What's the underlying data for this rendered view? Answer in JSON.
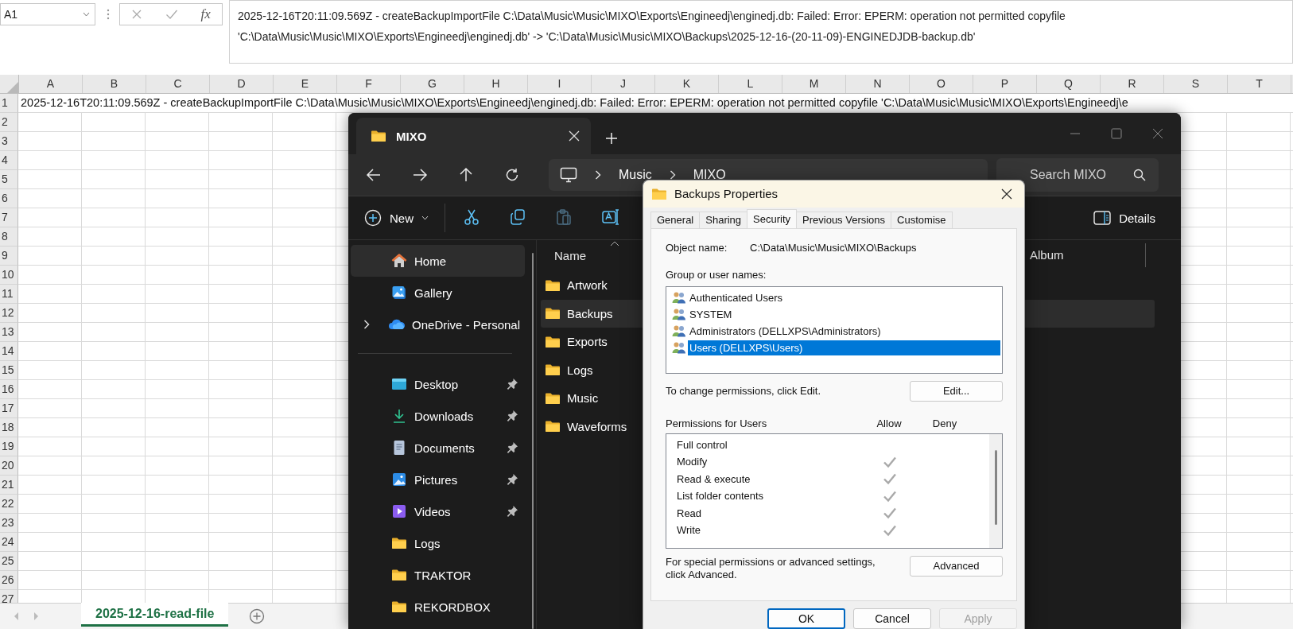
{
  "spreadsheet": {
    "name_box": "A1",
    "fx_label": "fx",
    "formula": "2025-12-16T20:11:09.569Z - createBackupImportFile C:\\Data\\Music\\Music\\MIXO\\Exports\\Engineedj\\enginedj.db: Failed: Error: EPERM: operation not permitted copyfile 'C:\\Data\\Music\\Music\\MIXO\\Exports\\Engineedj\\enginedj.db' -> 'C:\\Data\\Music\\Music\\MIXO\\Backups\\2025-12-16-(20-11-09)-ENGINEDJDB-backup.db'",
    "columns": [
      "A",
      "B",
      "C",
      "D",
      "E",
      "F",
      "G",
      "H",
      "I",
      "J",
      "K",
      "L",
      "M",
      "N",
      "O",
      "P",
      "Q",
      "R",
      "S",
      "T"
    ],
    "rows": [
      "1",
      "2",
      "3",
      "4",
      "5",
      "6",
      "7",
      "8",
      "9",
      "10",
      "11",
      "12",
      "13",
      "14",
      "15",
      "16",
      "17",
      "18",
      "19",
      "20",
      "21",
      "22",
      "23",
      "24",
      "25",
      "26",
      "27"
    ],
    "cell_a1": "2025-12-16T20:11:09.569Z - createBackupImportFile C:\\Data\\Music\\Music\\MIXO\\Exports\\Engineedj\\enginedj.db: Failed: Error: EPERM: operation not permitted copyfile 'C:\\Data\\Music\\Music\\MIXO\\Exports\\Engineedj\\e",
    "sheet_tabs": [
      {
        "label": "2025-12-16-read-file",
        "selected": true
      }
    ]
  },
  "explorer": {
    "tabs": [
      {
        "title": "MIXO",
        "selected": true
      }
    ],
    "breadcrumb": [
      "Music",
      "MIXO"
    ],
    "search": {
      "placeholder": "Search MIXO"
    },
    "new_label": "New",
    "toolbar_icons": [
      {
        "kind": "cut",
        "disabled": false
      },
      {
        "kind": "copy",
        "disabled": false
      },
      {
        "kind": "paste",
        "disabled": true
      },
      {
        "kind": "rename",
        "disabled": false
      }
    ],
    "details_label": "Details",
    "sidebar": {
      "sections": [
        {
          "items": [
            {
              "label": "Home",
              "kind": "home",
              "selected": true,
              "pinned": false
            },
            {
              "label": "Gallery",
              "kind": "gallery",
              "selected": false,
              "pinned": false
            },
            {
              "label": "OneDrive - Personal",
              "kind": "cloud",
              "selected": false,
              "pinned": false,
              "expanded": false
            }
          ]
        },
        {
          "items": [
            {
              "label": "Desktop",
              "kind": "desktop",
              "selected": false,
              "pinned": true
            },
            {
              "label": "Downloads",
              "kind": "downloads",
              "selected": false,
              "pinned": true
            },
            {
              "label": "Documents",
              "kind": "documents",
              "selected": false,
              "pinned": true
            },
            {
              "label": "Pictures",
              "kind": "pictures",
              "selected": false,
              "pinned": true
            },
            {
              "label": "Videos",
              "kind": "videos",
              "selected": false,
              "pinned": true
            },
            {
              "label": "Logs",
              "kind": "folder",
              "selected": false,
              "pinned": false
            },
            {
              "label": "TRAKTOR",
              "kind": "folder",
              "selected": false,
              "pinned": false
            },
            {
              "label": "REKORDBOX",
              "kind": "folder",
              "selected": false,
              "pinned": false
            }
          ]
        }
      ]
    },
    "file_list": {
      "columns": [
        "Name",
        "Album"
      ],
      "rows": [
        {
          "name": "Artwork",
          "selected": false
        },
        {
          "name": "Backups",
          "selected": true
        },
        {
          "name": "Exports",
          "selected": false
        },
        {
          "name": "Logs",
          "selected": false
        },
        {
          "name": "Music",
          "selected": false
        },
        {
          "name": "Waveforms",
          "selected": false
        }
      ]
    }
  },
  "properties_dialog": {
    "title": "Backups Properties",
    "tabs": [
      {
        "label": "General",
        "selected": false
      },
      {
        "label": "Sharing",
        "selected": false
      },
      {
        "label": "Security",
        "selected": true
      },
      {
        "label": "Previous Versions",
        "selected": false
      },
      {
        "label": "Customise",
        "selected": false
      }
    ],
    "object_name_label": "Object name:",
    "object_name": "C:\\Data\\Music\\Music\\MIXO\\Backups",
    "group_label": "Group or user names:",
    "users": [
      {
        "name": "Authenticated Users",
        "selected": false
      },
      {
        "name": "SYSTEM",
        "selected": false
      },
      {
        "name": "Administrators (DELLXPS\\Administrators)",
        "selected": false
      },
      {
        "name": "Users (DELLXPS\\Users)",
        "selected": true
      }
    ],
    "change_hint": "To change permissions, click Edit.",
    "edit_button": "Edit...",
    "permissions_label": "Permissions for Users",
    "allow_header": "Allow",
    "deny_header": "Deny",
    "permissions": [
      {
        "name": "Full control",
        "allow": false,
        "deny": false
      },
      {
        "name": "Modify",
        "allow": true,
        "deny": false
      },
      {
        "name": "Read & execute",
        "allow": true,
        "deny": false
      },
      {
        "name": "List folder contents",
        "allow": true,
        "deny": false
      },
      {
        "name": "Read",
        "allow": true,
        "deny": false
      },
      {
        "name": "Write",
        "allow": true,
        "deny": false
      }
    ],
    "advanced_hint": "For special permissions or advanced settings, click Advanced.",
    "advanced_button": "Advanced",
    "buttons": [
      {
        "label": "OK",
        "disabled": false
      },
      {
        "label": "Cancel",
        "disabled": false
      },
      {
        "label": "Apply",
        "disabled": true
      }
    ]
  }
}
